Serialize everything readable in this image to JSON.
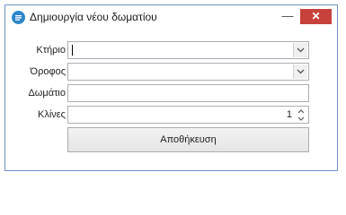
{
  "window": {
    "title": "Δημιουργία νέου δωματίου",
    "minimize_glyph": "—",
    "close_glyph": "✕",
    "app_icon": "app-logo-icon",
    "accent_color": "#c7423a"
  },
  "form": {
    "building": {
      "label": "Κτήριο",
      "value": ""
    },
    "floor": {
      "label": "Όροφος",
      "value": ""
    },
    "room": {
      "label": "Δωμάτιο",
      "value": ""
    },
    "beds": {
      "label": "Κλίνες",
      "value": "1"
    }
  },
  "actions": {
    "save_label": "Αποθήκευση"
  }
}
